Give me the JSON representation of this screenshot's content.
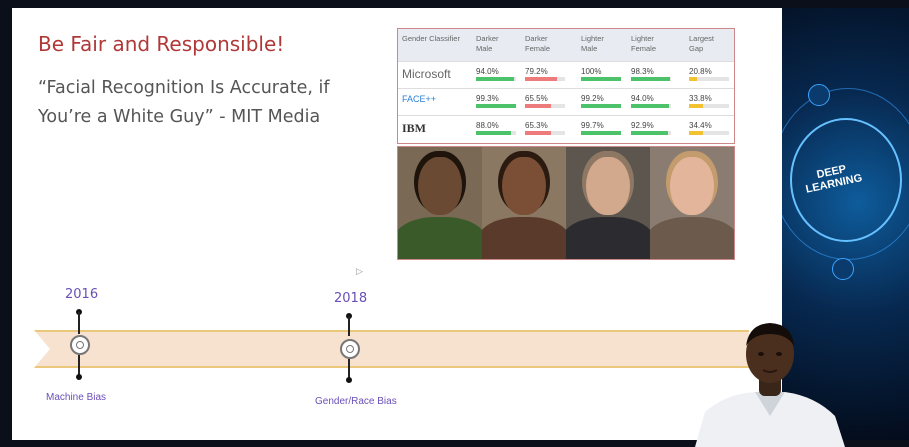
{
  "slide": {
    "title": "Be Fair and Responsible!",
    "quote": "“Facial Recognition Is Accurate, if You’re a White Guy” - MIT Media"
  },
  "table": {
    "headers": [
      "Gender Classifier",
      "Darker Male",
      "Darker Female",
      "Lighter Male",
      "Lighter Female",
      "Largest Gap"
    ],
    "rows": [
      {
        "company": "Microsoft",
        "values": [
          "94.0%",
          "79.2%",
          "100%",
          "98.3%",
          "20.8%"
        ],
        "levels": [
          0.94,
          0.792,
          1.0,
          0.983,
          0.208
        ]
      },
      {
        "company": "FACE++",
        "values": [
          "99.3%",
          "65.5%",
          "99.2%",
          "94.0%",
          "33.8%"
        ],
        "levels": [
          0.993,
          0.655,
          0.992,
          0.94,
          0.338
        ]
      },
      {
        "company": "IBM",
        "values": [
          "88.0%",
          "65.3%",
          "99.7%",
          "92.9%",
          "34.4%"
        ],
        "levels": [
          0.88,
          0.653,
          0.997,
          0.929,
          0.344
        ]
      }
    ],
    "bar_colors": [
      "#4cc26a",
      "#ee7b7b",
      "#4cc26a",
      "#4cc26a",
      "#f2c230"
    ]
  },
  "faces": [
    {
      "skin": "#6a4a33",
      "hair": "#1e140c",
      "bg": "#7a6a55",
      "cloth": "#3a5a2a"
    },
    {
      "skin": "#7a4f36",
      "hair": "#2a1a10",
      "bg": "#8a7862",
      "cloth": "#5a3a2a"
    },
    {
      "skin": "#d3a98e",
      "hair": "#8f7863",
      "bg": "#5c564f",
      "cloth": "#2c2c30"
    },
    {
      "skin": "#e3b69c",
      "hair": "#c49b6c",
      "bg": "#8a7c70",
      "cloth": "#6c5a4c"
    }
  ],
  "timeline": [
    {
      "year": "2016",
      "label": "Machine Bias"
    },
    {
      "year": "2018",
      "label": "Gender/Race Bias"
    }
  ],
  "deco": {
    "title_line1": "DEEP",
    "title_line2": "LEARNING"
  }
}
